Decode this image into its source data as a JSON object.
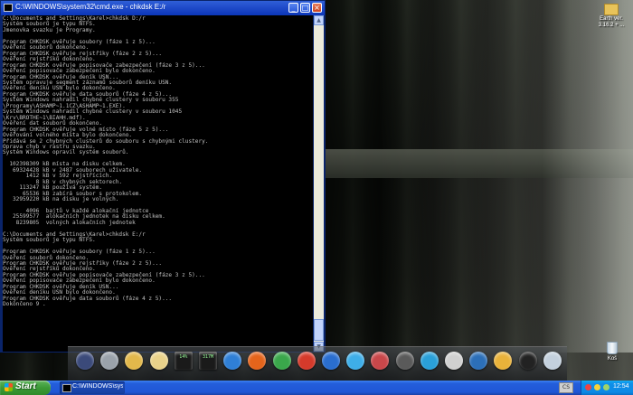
{
  "window": {
    "title": "C:\\WINDOWS\\system32\\cmd.exe - chkdsk E:/r",
    "controls": {
      "minimize": "_",
      "maximize": "□",
      "close": "×"
    }
  },
  "console": {
    "lines": [
      "C:\\Documents and Settings\\Karel>chkdsk D:/r",
      "Systém souborů je typu NTFS.",
      "Jmenovka svazku je Programy.",
      "",
      "Program CHKDSK ověřuje soubory (fáze 1 z 5)...",
      "Ověření souborů dokončeno.",
      "Program CHKDSK ověřuje rejstříky (fáze 2 z 5)...",
      "Ověření rejstříků dokončeno.",
      "Program CHKDSK ověřuje popisovače zabezpečení (fáze 3 z 5)...",
      "Ověření popisovače zabezpečení bylo dokončeno.",
      "Program CHKDSK ověřuje deník USN...",
      "Systém opravuje segment záznamů souborů deníku USN.",
      "Ověření deníku USN bylo dokončeno.",
      "Program CHKDSK ověřuje data souborů (fáze 4 z 5)...",
      "Systém Windows nahradil chybné clustery v souboru 355",
      "\\Programy\\ASHAMP~1.1CZ\\ASHAMP~1.EXE).",
      "Systém Windows nahradil chybné clustery v souboru 1045",
      "\\Krv\\BROTHE~1\\BIAHH.mdf).",
      "Ověření dat souborů dokončeno.",
      "Program CHKDSK ověřuje volné místo (fáze 5 z 5)...",
      "Ověřování volného místa bylo dokončeno.",
      "Přidává se 2 chybných clusterů do souboru s chybnými clustery.",
      "Oprava chyb v rastru svazku.",
      "Systém Windows opravil systém souborů.",
      "",
      "  102398309 kB místa na disku celkem.",
      "   69324428 kB v 2487 souborech uživatele.",
      "       1412 kB v 592 rejstřících.",
      "          8 kB v chybných sektorech.",
      "     113247 kB používá systém.",
      "      65536 kB zabírá soubor s protokolem.",
      "   32959220 kB na disku je volných.",
      "",
      "       4096  bajtů v každé alokační jednotce",
      "   25599577  alokačních jednotek na disku celkem.",
      "    8239805  volných alokačních jednotek",
      "",
      "C:\\Documents and Settings\\Karel>chkdsk E:/r",
      "Systém souborů je typu NTFS.",
      "",
      "Program CHKDSK ověřuje soubory (fáze 1 z 5)...",
      "Ověření souborů dokončeno.",
      "Program CHKDSK ověřuje rejstříky (fáze 2 z 5)...",
      "Ověření rejstříků dokončeno.",
      "Program CHKDSK ověřuje popisovače zabezpečení (fáze 3 z 5)...",
      "Ověření popisovače zabezpečení bylo dokončeno.",
      "Program CHKDSK ověřuje deník USN...",
      "Ověření deníku USN bylo dokončeno.",
      "Program CHKDSK ověřuje data souborů (fáze 4 z 5)...",
      "Dokončeno 9 ."
    ]
  },
  "desktop": {
    "icons": [
      {
        "label": "Earth ver. 3.16.2 + ...",
        "icon": "folder-icon"
      },
      {
        "label": "Koš",
        "icon": "recycle-bin-icon"
      }
    ]
  },
  "dock": {
    "items": [
      {
        "name": "nexus-icon",
        "color": "#3b4a7a",
        "label": ""
      },
      {
        "name": "scanner-icon",
        "color": "#9aa2aa",
        "label": ""
      },
      {
        "name": "folder-icon",
        "color": "#e2b84b",
        "label": ""
      },
      {
        "name": "weather-icon",
        "color": "#e9d28a",
        "label": ""
      },
      {
        "name": "cpu-meter-icon",
        "color": "#1a1a1a",
        "label": "14%"
      },
      {
        "name": "memory-meter-icon",
        "color": "#1a1a1a",
        "label": "317M"
      },
      {
        "name": "internet-explorer-icon",
        "color": "#2f7fd6",
        "label": ""
      },
      {
        "name": "firefox-icon",
        "color": "#e4641b",
        "label": ""
      },
      {
        "name": "chrome-icon",
        "color": "#3aa74b",
        "label": ""
      },
      {
        "name": "opera-icon",
        "color": "#d53a2b",
        "label": ""
      },
      {
        "name": "ccleaner-icon",
        "color": "#2a6ecf",
        "label": ""
      },
      {
        "name": "skype-icon",
        "color": "#3eaee8",
        "label": ""
      },
      {
        "name": "toolbox-icon",
        "color": "#c9474a",
        "label": ""
      },
      {
        "name": "owl-icon",
        "color": "#5a5a5a",
        "label": ""
      },
      {
        "name": "media-player-icon",
        "color": "#2aa0d8",
        "label": ""
      },
      {
        "name": "solitaire-icon",
        "color": "#d0d0d0",
        "label": ""
      },
      {
        "name": "google-earth-icon",
        "color": "#2c6fb8",
        "label": ""
      },
      {
        "name": "sun-weather-icon",
        "color": "#e9b23a",
        "label": ""
      },
      {
        "name": "clock-icon",
        "color": "#222",
        "label": ""
      },
      {
        "name": "recycle-bin-icon",
        "color": "#c3d0dd",
        "label": ""
      }
    ]
  },
  "taskbar": {
    "start_label": "Start",
    "tasks": [
      {
        "label": "C:\\WINDOWS\\syste..."
      }
    ],
    "tray_button": "CS",
    "clock": "12:54"
  }
}
